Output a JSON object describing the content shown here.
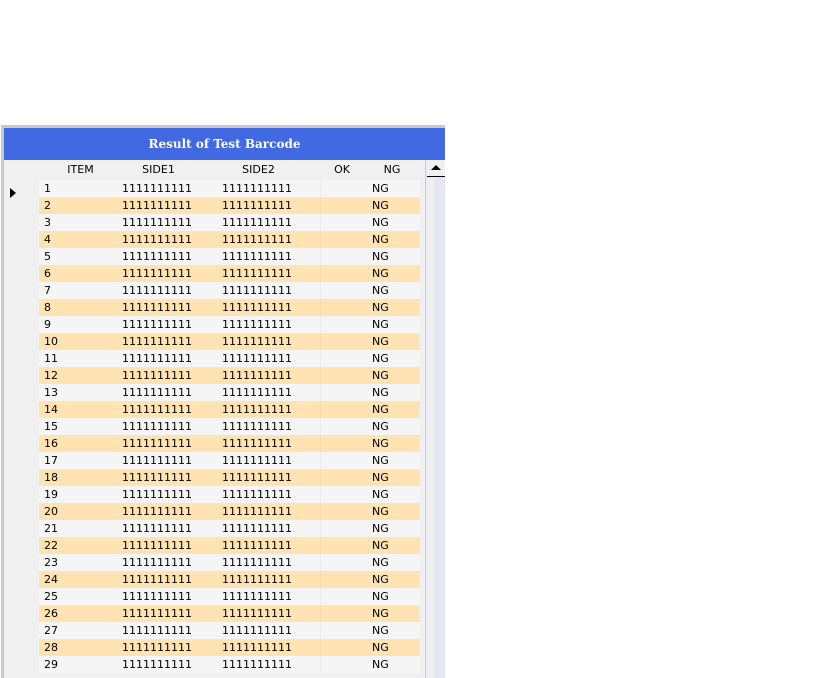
{
  "window": {
    "title": "Result of Test Barcode"
  },
  "table": {
    "columns": [
      "ITEM",
      "SIDE1",
      "SIDE2",
      "OK",
      "NG"
    ],
    "rows": [
      {
        "item": "1",
        "side1": "1111111111",
        "side2": "1111111111",
        "ok": "",
        "ng": "NG"
      },
      {
        "item": "2",
        "side1": "1111111111",
        "side2": "1111111111",
        "ok": "",
        "ng": "NG"
      },
      {
        "item": "3",
        "side1": "1111111111",
        "side2": "1111111111",
        "ok": "",
        "ng": "NG"
      },
      {
        "item": "4",
        "side1": "1111111111",
        "side2": "1111111111",
        "ok": "",
        "ng": "NG"
      },
      {
        "item": "5",
        "side1": "1111111111",
        "side2": "1111111111",
        "ok": "",
        "ng": "NG"
      },
      {
        "item": "6",
        "side1": "1111111111",
        "side2": "1111111111",
        "ok": "",
        "ng": "NG"
      },
      {
        "item": "7",
        "side1": "1111111111",
        "side2": "1111111111",
        "ok": "",
        "ng": "NG"
      },
      {
        "item": "8",
        "side1": "1111111111",
        "side2": "1111111111",
        "ok": "",
        "ng": "NG"
      },
      {
        "item": "9",
        "side1": "1111111111",
        "side2": "1111111111",
        "ok": "",
        "ng": "NG"
      },
      {
        "item": "10",
        "side1": "1111111111",
        "side2": "1111111111",
        "ok": "",
        "ng": "NG"
      },
      {
        "item": "11",
        "side1": "1111111111",
        "side2": "1111111111",
        "ok": "",
        "ng": "NG"
      },
      {
        "item": "12",
        "side1": "1111111111",
        "side2": "1111111111",
        "ok": "",
        "ng": "NG"
      },
      {
        "item": "13",
        "side1": "1111111111",
        "side2": "1111111111",
        "ok": "",
        "ng": "NG"
      },
      {
        "item": "14",
        "side1": "1111111111",
        "side2": "1111111111",
        "ok": "",
        "ng": "NG"
      },
      {
        "item": "15",
        "side1": "1111111111",
        "side2": "1111111111",
        "ok": "",
        "ng": "NG"
      },
      {
        "item": "16",
        "side1": "1111111111",
        "side2": "1111111111",
        "ok": "",
        "ng": "NG"
      },
      {
        "item": "17",
        "side1": "1111111111",
        "side2": "1111111111",
        "ok": "",
        "ng": "NG"
      },
      {
        "item": "18",
        "side1": "1111111111",
        "side2": "1111111111",
        "ok": "",
        "ng": "NG"
      },
      {
        "item": "19",
        "side1": "1111111111",
        "side2": "1111111111",
        "ok": "",
        "ng": "NG"
      },
      {
        "item": "20",
        "side1": "1111111111",
        "side2": "1111111111",
        "ok": "",
        "ng": "NG"
      },
      {
        "item": "21",
        "side1": "1111111111",
        "side2": "1111111111",
        "ok": "",
        "ng": "NG"
      },
      {
        "item": "22",
        "side1": "1111111111",
        "side2": "1111111111",
        "ok": "",
        "ng": "NG"
      },
      {
        "item": "23",
        "side1": "1111111111",
        "side2": "1111111111",
        "ok": "",
        "ng": "NG"
      },
      {
        "item": "24",
        "side1": "1111111111",
        "side2": "1111111111",
        "ok": "",
        "ng": "NG"
      },
      {
        "item": "25",
        "side1": "1111111111",
        "side2": "1111111111",
        "ok": "",
        "ng": "NG"
      },
      {
        "item": "26",
        "side1": "1111111111",
        "side2": "1111111111",
        "ok": "",
        "ng": "NG"
      },
      {
        "item": "27",
        "side1": "1111111111",
        "side2": "1111111111",
        "ok": "",
        "ng": "NG"
      },
      {
        "item": "28",
        "side1": "1111111111",
        "side2": "1111111111",
        "ok": "",
        "ng": "NG"
      },
      {
        "item": "29",
        "side1": "1111111111",
        "side2": "1111111111",
        "ok": "",
        "ng": "NG"
      }
    ]
  },
  "icons": {
    "row_indicator": "current-row-arrow-icon",
    "scroll_up": "scroll-up-arrow-icon"
  },
  "colors": {
    "title_bar": "#4169e1",
    "row_alt": "#ffe3b3",
    "row_base": "#f5f5f5"
  }
}
